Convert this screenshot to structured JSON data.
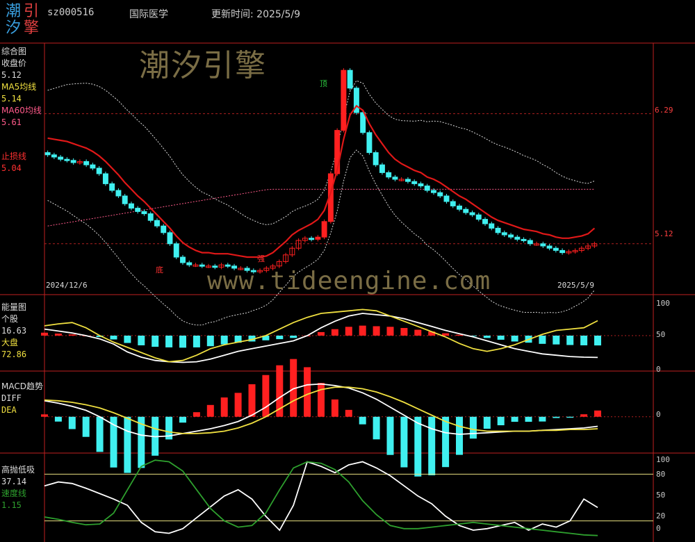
{
  "header": {
    "logo_chars": [
      "潮",
      "引",
      "汐",
      "擎"
    ],
    "code": "sz000516",
    "name": "国际医学",
    "update_label": "更新时间: 2025/5/9"
  },
  "watermarks": {
    "brand": "潮汐引擎",
    "url": "www.tideengine.com"
  },
  "panels": {
    "main": {
      "title": "综合图",
      "items": [
        {
          "label": "收盘价",
          "value": "5.12",
          "color": "#dddddd"
        },
        {
          "label": "MA5均线",
          "value": "5.14",
          "color": "#f0e040"
        },
        {
          "label": "MA60均线",
          "value": "5.61",
          "color": "#ff5a8a"
        },
        {
          "label": "止损线",
          "value": "5.04",
          "color": "#ff3030"
        }
      ],
      "right_labels": [
        "6.29",
        "5.12"
      ],
      "date_start": "2024/12/6",
      "date_end": "2025/5/9",
      "markers": {
        "bottom": "底",
        "top": "顶",
        "strong": "强"
      }
    },
    "energy": {
      "title": "能量图",
      "items": [
        {
          "label": "个股",
          "value": "16.63",
          "color": "#dddddd"
        },
        {
          "label": "大盘",
          "value": "72.86",
          "color": "#f0e040"
        }
      ],
      "right_labels": [
        "100",
        "50",
        "0"
      ]
    },
    "macd": {
      "title": "MACD趋势",
      "items": [
        {
          "label": "DIFF",
          "value": "",
          "color": "#dddddd"
        },
        {
          "label": "DEA",
          "value": "",
          "color": "#f0e040"
        }
      ],
      "right_labels": [
        "0"
      ]
    },
    "osc": {
      "title": "高抛低吸",
      "items": [
        {
          "label": "",
          "value": "37.14",
          "color": "#dddddd"
        },
        {
          "label": "速度线",
          "value": "1.15",
          "color": "#2ea02e"
        }
      ],
      "right_labels": [
        "100",
        "80",
        "50",
        "20",
        "0"
      ]
    }
  },
  "chart_data": [
    {
      "type": "candlestick",
      "title": "综合图",
      "x_start": "2024/12/6",
      "x_end": "2025/5/9",
      "ylim": [
        4.7,
        6.9
      ],
      "closes": [
        5.92,
        5.9,
        5.88,
        5.87,
        5.85,
        5.86,
        5.83,
        5.8,
        5.75,
        5.66,
        5.6,
        5.55,
        5.48,
        5.44,
        5.41,
        5.39,
        5.33,
        5.28,
        5.22,
        5.12,
        5.0,
        4.95,
        4.93,
        4.93,
        4.92,
        4.92,
        4.91,
        4.93,
        4.92,
        4.9,
        4.9,
        4.88,
        4.87,
        4.88,
        4.9,
        4.92,
        4.96,
        5.02,
        5.08,
        5.15,
        5.17,
        5.16,
        5.18,
        5.32,
        5.75,
        6.14,
        6.68,
        6.52,
        6.3,
        6.12,
        5.94,
        5.83,
        5.76,
        5.72,
        5.7,
        5.7,
        5.68,
        5.66,
        5.64,
        5.6,
        5.58,
        5.55,
        5.5,
        5.46,
        5.43,
        5.4,
        5.38,
        5.34,
        5.3,
        5.26,
        5.22,
        5.2,
        5.18,
        5.16,
        5.15,
        5.12,
        5.12,
        5.1,
        5.08,
        5.06,
        5.04,
        5.05,
        5.06,
        5.08,
        5.1,
        5.12
      ],
      "ma5": [
        5.95,
        5.94,
        5.93,
        5.92,
        5.9,
        5.88,
        5.86,
        5.83,
        5.79,
        5.74,
        5.68,
        5.62,
        5.55,
        5.49,
        5.43,
        5.38,
        5.32,
        5.26,
        5.2,
        5.14,
        5.07,
        5.01,
        4.97,
        4.94,
        4.92,
        4.92,
        4.91,
        4.91,
        4.91,
        4.9,
        4.89,
        4.88,
        4.88,
        4.88,
        4.89,
        4.92,
        4.97,
        5.02,
        5.08,
        5.12,
        5.15,
        5.18,
        5.22,
        5.3,
        5.46,
        5.66,
        5.94,
        6.16,
        6.24,
        6.2,
        6.08,
        5.98,
        5.9,
        5.82,
        5.76,
        5.72,
        5.69,
        5.66,
        5.64,
        5.6,
        5.58,
        5.55,
        5.51,
        5.47,
        5.43,
        5.4,
        5.36,
        5.32,
        5.28,
        5.24,
        5.21,
        5.19,
        5.17,
        5.15,
        5.13,
        5.12,
        5.11,
        5.09,
        5.08,
        5.06,
        5.05,
        5.05,
        5.06,
        5.07,
        5.09,
        5.14
      ],
      "ma60_range": [
        5.28,
        5.61
      ],
      "horizontal_levels": [
        6.29,
        5.12
      ]
    },
    {
      "type": "bar+line",
      "title": "能量图",
      "ylim": [
        0,
        100
      ],
      "series": [
        {
          "name": "个股",
          "values": [
            60,
            57,
            54,
            50,
            45,
            37,
            25,
            17,
            12,
            10,
            9,
            10,
            14,
            20,
            26,
            30,
            34,
            38,
            42,
            50,
            62,
            72,
            80,
            84,
            82,
            80,
            76,
            70,
            64,
            58,
            53,
            48,
            42,
            36,
            30,
            26,
            22,
            20,
            18,
            17,
            16.63
          ]
        },
        {
          "name": "大盘",
          "values": [
            65,
            68,
            70,
            62,
            50,
            40,
            32,
            24,
            16,
            10,
            12,
            20,
            30,
            36,
            40,
            44,
            50,
            60,
            70,
            78,
            84,
            86,
            88,
            90,
            88,
            80,
            72,
            64,
            56,
            48,
            38,
            30,
            26,
            30,
            36,
            44,
            52,
            58,
            60,
            62,
            72.86
          ]
        }
      ]
    },
    {
      "type": "bar+line",
      "title": "MACD趋势",
      "ylim": [
        -0.35,
        0.45
      ],
      "series": [
        {
          "name": "DIFF",
          "values": [
            0.2,
            0.17,
            0.13,
            0.08,
            0.0,
            -0.1,
            -0.18,
            -0.23,
            -0.25,
            -0.24,
            -0.21,
            -0.18,
            -0.15,
            -0.11,
            -0.06,
            0.02,
            0.12,
            0.24,
            0.35,
            0.4,
            0.41,
            0.39,
            0.36,
            0.3,
            0.22,
            0.12,
            0.02,
            -0.08,
            -0.15,
            -0.2,
            -0.22,
            -0.21,
            -0.2,
            -0.19,
            -0.18,
            -0.18,
            -0.17,
            -0.16,
            -0.15,
            -0.14,
            -0.12
          ]
        },
        {
          "name": "DEA",
          "values": [
            0.21,
            0.2,
            0.18,
            0.15,
            0.11,
            0.05,
            -0.02,
            -0.09,
            -0.15,
            -0.19,
            -0.21,
            -0.21,
            -0.2,
            -0.18,
            -0.14,
            -0.08,
            0.0,
            0.1,
            0.2,
            0.28,
            0.34,
            0.37,
            0.37,
            0.35,
            0.31,
            0.25,
            0.18,
            0.1,
            0.02,
            -0.06,
            -0.12,
            -0.16,
            -0.18,
            -0.18,
            -0.18,
            -0.18,
            -0.17,
            -0.17,
            -0.16,
            -0.16,
            -0.15
          ]
        }
      ]
    },
    {
      "type": "line",
      "title": "高抛低吸",
      "ylim": [
        0,
        100
      ],
      "ticks": [
        100,
        80,
        50,
        20,
        0
      ],
      "series": [
        {
          "name": "",
          "values": [
            65,
            70,
            68,
            62,
            55,
            48,
            40,
            18,
            6,
            4,
            10,
            24,
            38,
            52,
            60,
            48,
            26,
            8,
            40,
            96,
            90,
            82,
            92,
            96,
            88,
            78,
            65,
            52,
            42,
            26,
            14,
            8,
            10,
            14,
            18,
            8,
            16,
            12,
            20,
            48,
            37.14
          ]
        },
        {
          "name": "速度线",
          "values": [
            25,
            22,
            18,
            15,
            16,
            30,
            60,
            90,
            98,
            96,
            84,
            60,
            36,
            20,
            12,
            14,
            30,
            60,
            88,
            96,
            94,
            86,
            70,
            46,
            28,
            14,
            10,
            10,
            12,
            14,
            16,
            18,
            16,
            14,
            12,
            10,
            8,
            6,
            4,
            2,
            1.15
          ]
        }
      ]
    }
  ]
}
